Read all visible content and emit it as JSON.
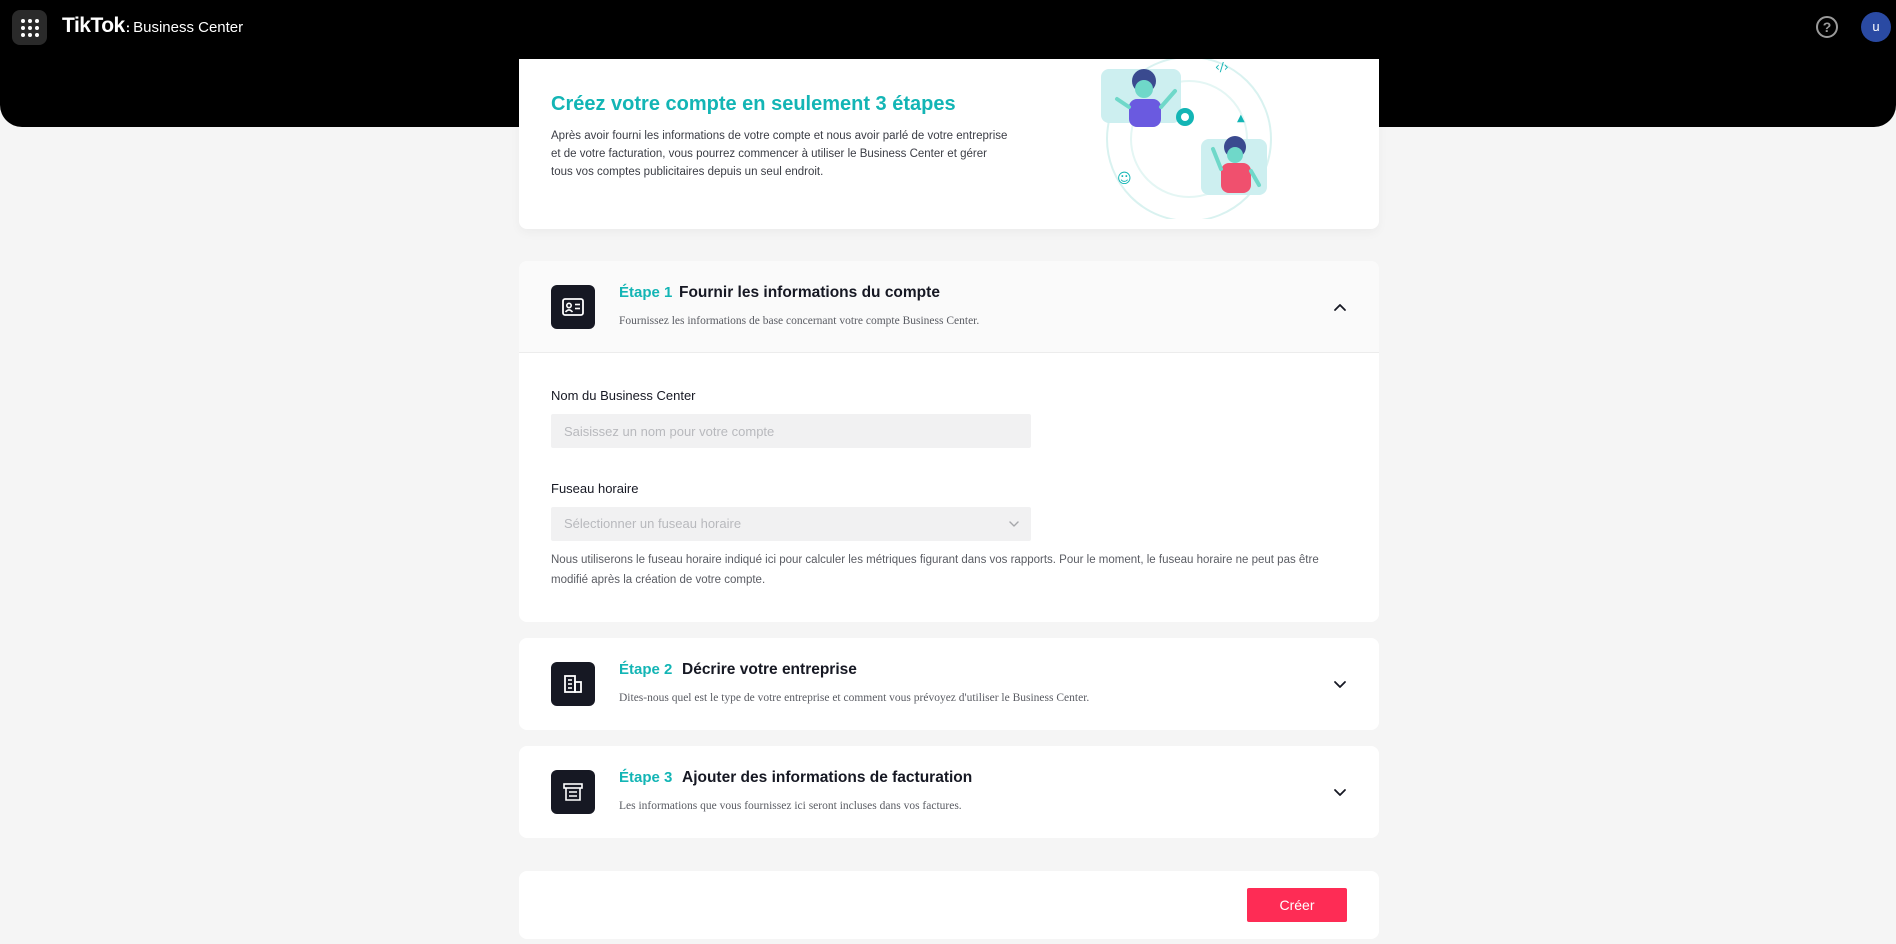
{
  "header": {
    "apps_icon": "grid-icon",
    "brand": "TikTok",
    "brand_separator": ":",
    "product": "Business Center",
    "help_icon": "question-icon",
    "help_glyph": "?",
    "avatar_letter": "u",
    "avatar_color": "#2a4aa3"
  },
  "hero": {
    "title": "Créez votre compte en seulement 3 étapes",
    "description": "Après avoir fourni les informations de votre compte et nous avoir parlé de votre entreprise et de votre facturation, vous pourrez commencer à utiliser le Business Center et gérer tous vos comptes publicitaires depuis un seul endroit."
  },
  "steps": [
    {
      "number": "Étape 1",
      "title": "Fournir les informations du compte",
      "subtitle": "Fournissez les informations de base concernant votre compte Business Center.",
      "icon": "id-card-icon",
      "expanded": true
    },
    {
      "number": "Étape 2",
      "title": "Décrire votre entreprise",
      "subtitle": "Dites-nous quel est le type de votre entreprise et comment vous prévoyez d'utiliser le Business Center.",
      "icon": "building-icon",
      "expanded": false
    },
    {
      "number": "Étape 3",
      "title": "Ajouter des informations de facturation",
      "subtitle": "Les informations que vous fournissez ici seront incluses dans vos factures.",
      "icon": "receipt-icon",
      "expanded": false
    }
  ],
  "form": {
    "name_label": "Nom du Business Center",
    "name_placeholder": "Saisissez un nom pour votre compte",
    "name_value": "",
    "timezone_label": "Fuseau horaire",
    "timezone_placeholder": "Sélectionner un fuseau horaire",
    "timezone_help": "Nous utiliserons le fuseau horaire indiqué ici pour calculer les métriques figurant dans vos rapports. Pour le moment, le fuseau horaire ne peut pas être modifié après la création de votre compte."
  },
  "footer": {
    "create_label": "Créer"
  },
  "colors": {
    "accent": "#13b5b5",
    "primary_button": "#fe2c55",
    "topbar": "#000000",
    "background": "#f5f5f5"
  }
}
